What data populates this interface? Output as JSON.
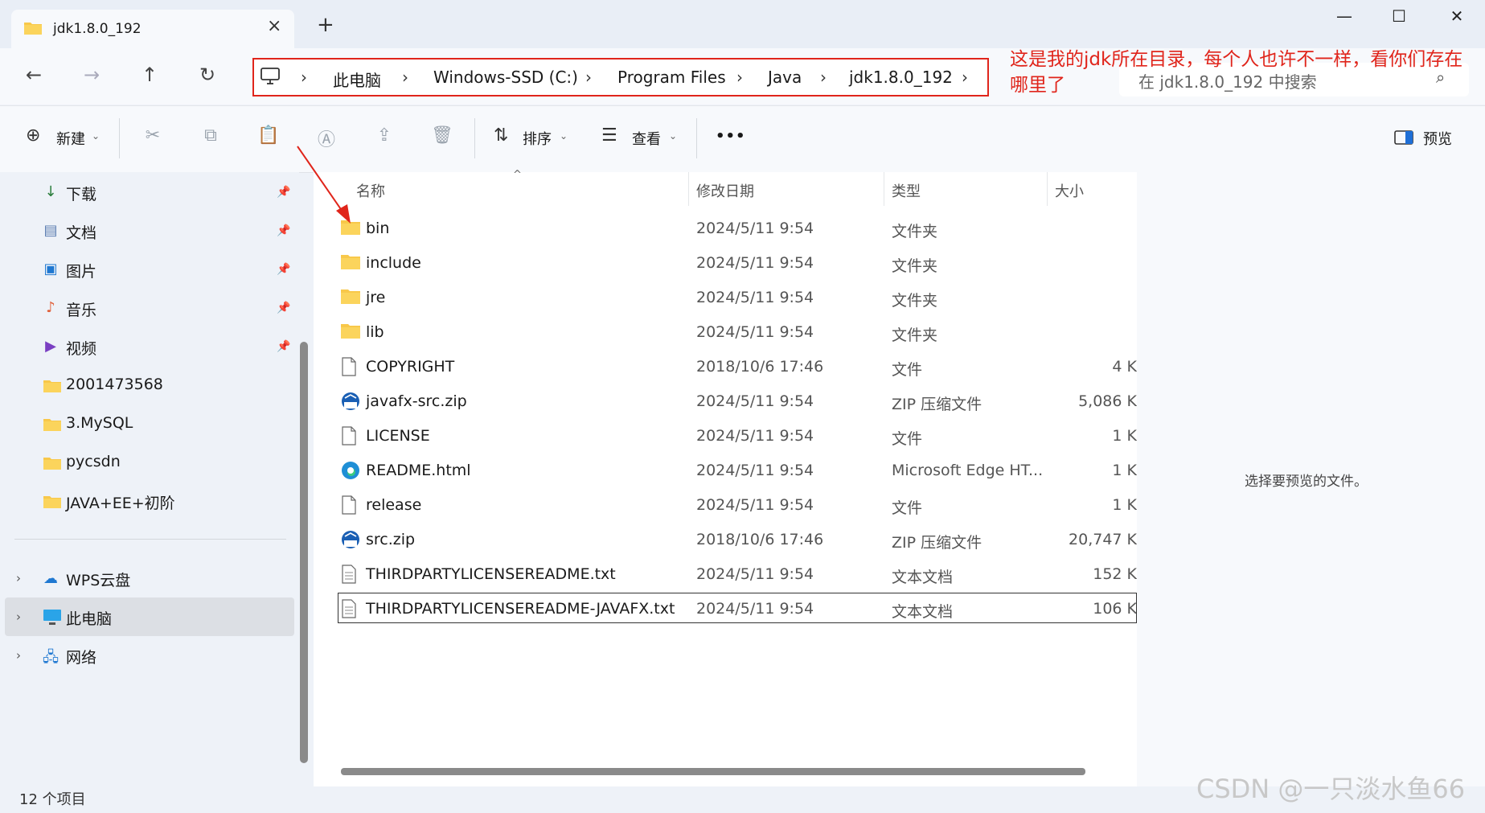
{
  "tab": {
    "title": "jdk1.8.0_192",
    "close": "×",
    "new_tab": "+"
  },
  "window": {
    "minimize": "—",
    "maximize": "☐",
    "close": "✕"
  },
  "nav": {
    "back": "←",
    "forward": "→",
    "up": "↑",
    "refresh": "↻"
  },
  "breadcrumb": {
    "sep": "›",
    "items": [
      "此电脑",
      "Windows-SSD (C:)",
      "Program Files",
      "Java",
      "jdk1.8.0_192"
    ]
  },
  "annotation": "这是我的jdk所在目录，每个人也许不一样，看你们存在哪里了",
  "search": {
    "placeholder": "在 jdk1.8.0_192 中搜索"
  },
  "toolbar": {
    "new_label": "新建",
    "sort_label": "排序",
    "view_label": "查看",
    "more_label": "•••",
    "preview_label": "预览"
  },
  "sidebar": {
    "quick": [
      {
        "label": "下载",
        "icon": "download-icon"
      },
      {
        "label": "文档",
        "icon": "document-icon"
      },
      {
        "label": "图片",
        "icon": "picture-icon"
      },
      {
        "label": "音乐",
        "icon": "music-icon"
      },
      {
        "label": "视频",
        "icon": "video-icon"
      },
      {
        "label": "2001473568",
        "icon": "folder-icon"
      },
      {
        "label": "3.MySQL",
        "icon": "folder-icon"
      },
      {
        "label": "pycsdn",
        "icon": "folder-icon"
      },
      {
        "label": "JAVA+EE+初阶",
        "icon": "folder-icon"
      }
    ],
    "locations": [
      {
        "label": "WPS云盘",
        "icon": "cloud-icon"
      },
      {
        "label": "此电脑",
        "icon": "computer-icon"
      },
      {
        "label": "网络",
        "icon": "network-icon"
      }
    ]
  },
  "columns": {
    "name": "名称",
    "date": "修改日期",
    "type": "类型",
    "size": "大小"
  },
  "files": [
    {
      "name": "bin",
      "date": "2024/5/11 9:54",
      "type": "文件夹",
      "size": "",
      "icon": "folder-icon"
    },
    {
      "name": "include",
      "date": "2024/5/11 9:54",
      "type": "文件夹",
      "size": "",
      "icon": "folder-icon"
    },
    {
      "name": "jre",
      "date": "2024/5/11 9:54",
      "type": "文件夹",
      "size": "",
      "icon": "folder-icon"
    },
    {
      "name": "lib",
      "date": "2024/5/11 9:54",
      "type": "文件夹",
      "size": "",
      "icon": "folder-icon"
    },
    {
      "name": "COPYRIGHT",
      "date": "2018/10/6 17:46",
      "type": "文件",
      "size": "4 K",
      "icon": "file-icon"
    },
    {
      "name": "javafx-src.zip",
      "date": "2024/5/11 9:54",
      "type": "ZIP 压缩文件",
      "size": "5,086 K",
      "icon": "zip-icon"
    },
    {
      "name": "LICENSE",
      "date": "2024/5/11 9:54",
      "type": "文件",
      "size": "1 K",
      "icon": "file-icon"
    },
    {
      "name": "README.html",
      "date": "2024/5/11 9:54",
      "type": "Microsoft Edge HT...",
      "size": "1 K",
      "icon": "edge-icon"
    },
    {
      "name": "release",
      "date": "2024/5/11 9:54",
      "type": "文件",
      "size": "1 K",
      "icon": "file-icon"
    },
    {
      "name": "src.zip",
      "date": "2018/10/6 17:46",
      "type": "ZIP 压缩文件",
      "size": "20,747 K",
      "icon": "zip-icon"
    },
    {
      "name": "THIRDPARTYLICENSEREADME.txt",
      "date": "2024/5/11 9:54",
      "type": "文本文档",
      "size": "152 K",
      "icon": "text-file-icon"
    },
    {
      "name": "THIRDPARTYLICENSEREADME-JAVAFX.txt",
      "date": "2024/5/11 9:54",
      "type": "文本文档",
      "size": "106 K",
      "icon": "text-file-icon"
    }
  ],
  "preview_message": "选择要预览的文件。",
  "status": "12 个项目",
  "watermark": "CSDN @一只淡水鱼66",
  "colors": {
    "accent_red": "#e0251b",
    "folder": "#f8c84a"
  }
}
